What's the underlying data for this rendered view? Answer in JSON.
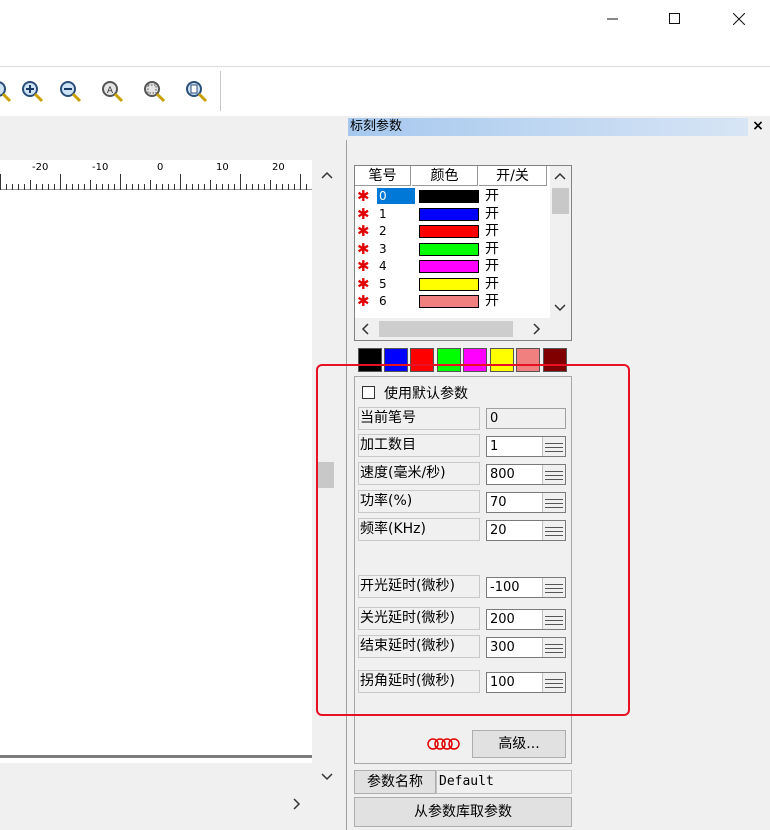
{
  "window": {
    "minimize_glyph": "—",
    "maximize_glyph": "☐",
    "close_glyph": "✕"
  },
  "toolbar": {
    "icons": [
      "zoom-in-icon",
      "zoom-out-icon",
      "zoom-all-icon",
      "zoom-select-icon",
      "zoom-page-icon"
    ]
  },
  "ruler": {
    "ticks": [
      "-20",
      "-10",
      "0",
      "10",
      "20"
    ]
  },
  "panel": {
    "title": "标刻参数",
    "close": "×",
    "pen_table": {
      "headers": [
        "笔号",
        "颜色",
        "开/关"
      ],
      "rows": [
        {
          "num": "0",
          "color": "#000000",
          "state": "开"
        },
        {
          "num": "1",
          "color": "#0000ff",
          "state": "开"
        },
        {
          "num": "2",
          "color": "#ff0000",
          "state": "开"
        },
        {
          "num": "3",
          "color": "#00ff00",
          "state": "开"
        },
        {
          "num": "4",
          "color": "#ff00ff",
          "state": "开"
        },
        {
          "num": "5",
          "color": "#ffff00",
          "state": "开"
        },
        {
          "num": "6",
          "color": "#f08080",
          "state": "开"
        }
      ]
    },
    "palette": [
      "#000000",
      "#0000ff",
      "#ff0000",
      "#00ff00",
      "#ff00ff",
      "#ffff00",
      "#f08080",
      "#800000"
    ],
    "params": {
      "use_default_label": "使用默认参数",
      "current_pen_label": "当前笔号",
      "current_pen_value": "0",
      "count_label": "加工数目",
      "count_value": "1",
      "speed_label": "速度(毫米/秒)",
      "speed_value": "800",
      "power_label": "功率(%)",
      "power_value": "70",
      "freq_label": "频率(KHz)",
      "freq_value": "20",
      "on_delay_label": "开光延时(微秒)",
      "on_delay_value": "-100",
      "off_delay_label": "关光延时(微秒)",
      "off_delay_value": "200",
      "end_delay_label": "结束延时(微秒)",
      "end_delay_value": "300",
      "corner_delay_label": "拐角延时(微秒)",
      "corner_delay_value": "100"
    },
    "advanced_label": "高级...",
    "param_name_label": "参数名称",
    "param_name_value": "Default",
    "get_from_lib_label": "从参数库取参数"
  }
}
